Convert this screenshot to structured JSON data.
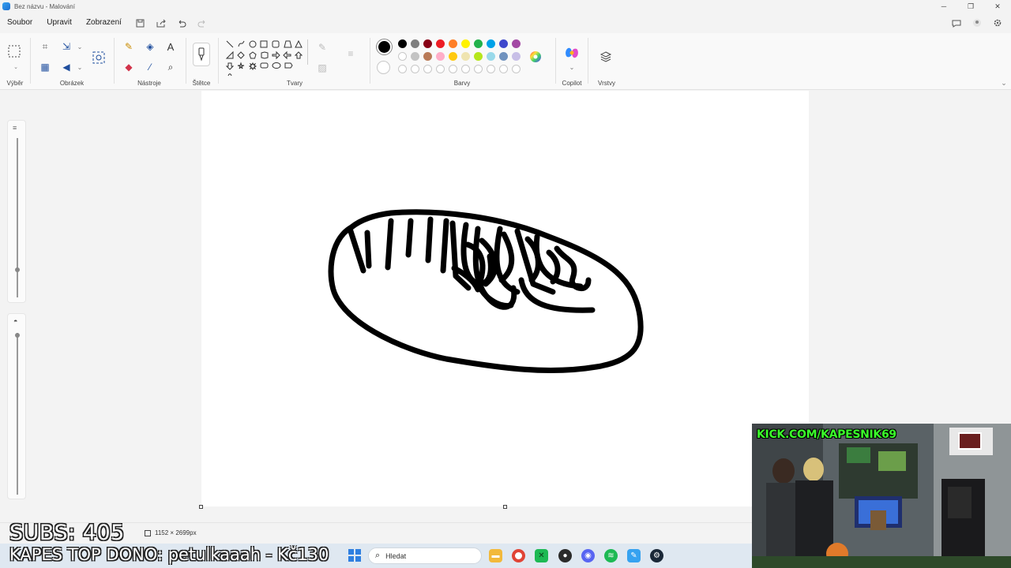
{
  "window": {
    "title": "Bez názvu - Malování"
  },
  "menu": {
    "file": "Soubor",
    "edit": "Upravit",
    "view": "Zobrazení"
  },
  "ribbon": {
    "groups": {
      "selection": "Výběr",
      "image": "Obrázek",
      "tools": "Nástroje",
      "brushes": "Štětce",
      "shapes": "Tvary",
      "colors": "Barvy",
      "copilot": "Copilot",
      "layers": "Vrstvy"
    },
    "colors": {
      "primary": "#000000",
      "secondary": "#ffffff",
      "row1": [
        "#000000",
        "#7f7f7f",
        "#880015",
        "#ed1c24",
        "#ff7f27",
        "#fff200",
        "#22b14c",
        "#00a2e8",
        "#3f48cc",
        "#a349a4"
      ],
      "row2": [
        "#ffffff",
        "#c3c3c3",
        "#b97a57",
        "#ffaec9",
        "#ffc90e",
        "#efe4b0",
        "#b5e61d",
        "#99d9ea",
        "#7092be",
        "#c8bfe7"
      ]
    }
  },
  "status": {
    "canvas_size": "1152 × 2699px"
  },
  "overlay": {
    "subs": "SUBS: 405",
    "dono": "KAPES TOP DONO: petulkaaah - Kč130",
    "kick": "KICK.COM/KAPESNIK69"
  },
  "taskbar": {
    "search_placeholder": "Hledat"
  }
}
